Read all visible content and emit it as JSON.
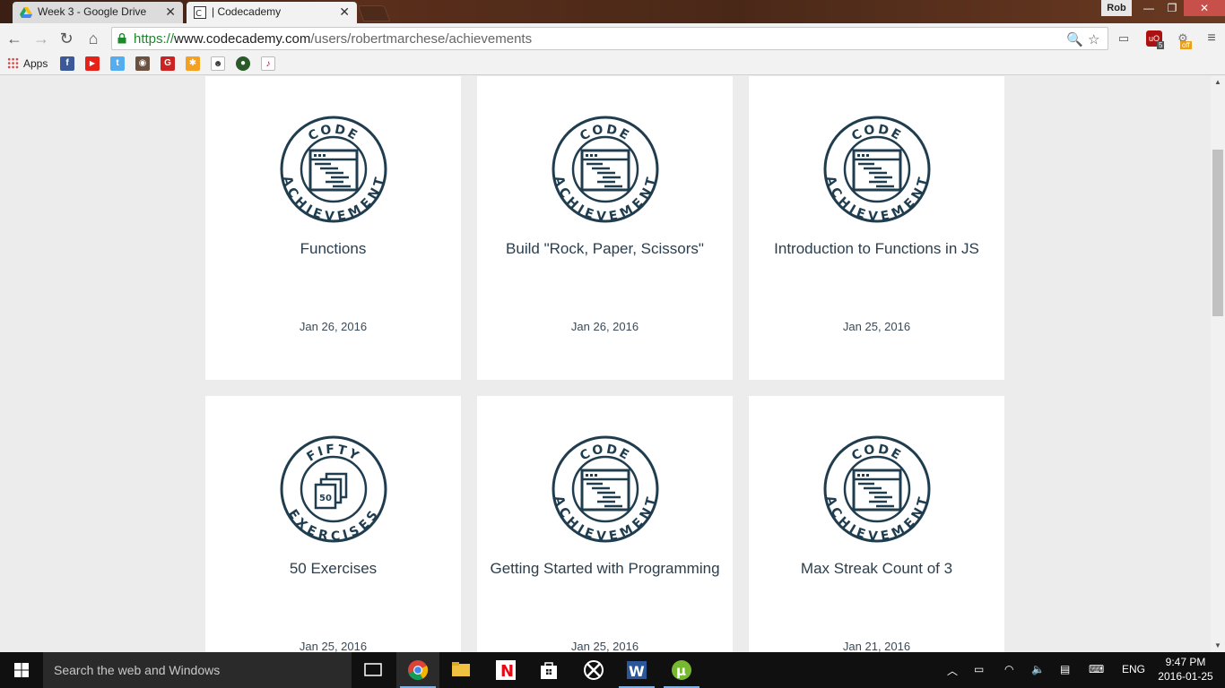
{
  "browser": {
    "tabs": [
      {
        "title": "Week 3 - Google Drive",
        "active": false
      },
      {
        "title": "| Codecademy",
        "active": true
      }
    ],
    "user_name": "Rob",
    "url_scheme": "https://",
    "url_host": "www.codecademy.com",
    "url_path": "/users/robertmarchese/achievements",
    "bookmarks_apps_label": "Apps",
    "extension_badges": {
      "ublock_count": "5",
      "off_label": "off"
    }
  },
  "achievements": [
    {
      "title": "Functions",
      "date": "Jan 26, 2016",
      "badge_top": "CODE",
      "badge_bottom": "ACHIEVEMENT",
      "badge_type": "code"
    },
    {
      "title": "Build \"Rock, Paper, Scissors\"",
      "date": "Jan 26, 2016",
      "badge_top": "CODE",
      "badge_bottom": "ACHIEVEMENT",
      "badge_type": "code"
    },
    {
      "title": "Introduction to Functions in JS",
      "date": "Jan 25, 2016",
      "badge_top": "CODE",
      "badge_bottom": "ACHIEVEMENT",
      "badge_type": "code"
    },
    {
      "title": "50 Exercises",
      "date": "Jan 25, 2016",
      "badge_top": "FIFTY",
      "badge_bottom": "EXERCISES",
      "badge_number": "50",
      "badge_type": "exercises"
    },
    {
      "title": "Getting Started with Programming",
      "date": "Jan 25, 2016",
      "badge_top": "CODE",
      "badge_bottom": "ACHIEVEMENT",
      "badge_type": "code"
    },
    {
      "title": "Max Streak Count of 3",
      "date": "Jan 21, 2016",
      "badge_top": "CODE",
      "badge_bottom": "ACHIEVEMENT",
      "badge_type": "code"
    }
  ],
  "taskbar": {
    "search_placeholder": "Search the web and Windows",
    "language": "ENG",
    "time": "9:47 PM",
    "date": "2016-01-25"
  },
  "colors": {
    "badge_ink": "#1f3d4f",
    "title_text": "#2c3e4c",
    "page_background": "#ececec",
    "url_scheme_green": "#1a8a2a"
  }
}
